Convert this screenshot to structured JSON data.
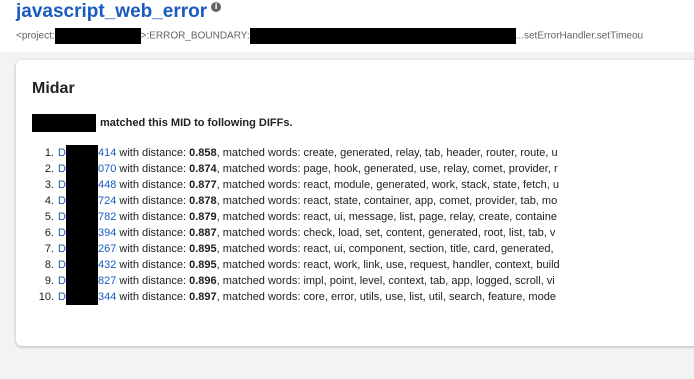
{
  "header": {
    "title": "javascript_web_error",
    "info_icon": "info-icon",
    "path_prefix": "<project:",
    "path_mid": ">:ERROR_BOUNDARY:",
    "path_suffix": "...setErrorHandler.setTimeou"
  },
  "card": {
    "title": "Midar",
    "matched_text": "matched this MID to following DIFFs.",
    "distance_label": "with distance:",
    "words_label": ", matched words:",
    "diffs": [
      {
        "num": "1.",
        "prefix": "D",
        "suffix": "414",
        "distance": "0.858",
        "words": "create, generated, relay, tab, header, router, route, u"
      },
      {
        "num": "2.",
        "prefix": "D",
        "suffix": "070",
        "distance": "0.874",
        "words": "page, hook, generated, use, relay, comet, provider, r"
      },
      {
        "num": "3.",
        "prefix": "D",
        "suffix": "448",
        "distance": "0.877",
        "words": "react, module, generated, work, stack, state, fetch, u"
      },
      {
        "num": "4.",
        "prefix": "D",
        "suffix": "724",
        "distance": "0.878",
        "words": "react, state, container, app, comet, provider, tab, mo"
      },
      {
        "num": "5.",
        "prefix": "D",
        "suffix": "782",
        "distance": "0.879",
        "words": "react, ui, message, list, page, relay, create, containe"
      },
      {
        "num": "6.",
        "prefix": "D",
        "suffix": "394",
        "distance": "0.887",
        "words": "check, load, set, content, generated, root, list, tab, v"
      },
      {
        "num": "7.",
        "prefix": "D",
        "suffix": "267",
        "distance": "0.895",
        "words": "react, ui, component, section, title, card, generated,"
      },
      {
        "num": "8.",
        "prefix": "D",
        "suffix": "432",
        "distance": "0.895",
        "words": "react, work, link, use, request, handler, context, build"
      },
      {
        "num": "9.",
        "prefix": "D",
        "suffix": "827",
        "distance": "0.896",
        "words": "impl, point, level, context, tab, app, logged, scroll, vi"
      },
      {
        "num": "10.",
        "prefix": "D",
        "suffix": "344",
        "distance": "0.897",
        "words": "core, error, utils, use, list, util, search, feature, mode"
      }
    ]
  }
}
